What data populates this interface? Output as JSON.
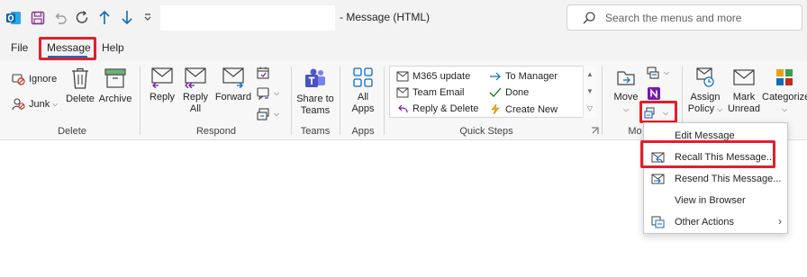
{
  "window": {
    "title": "- Message (HTML)",
    "search_placeholder": "Search the menus and more"
  },
  "menu": {
    "file": "File",
    "message": "Message",
    "help": "Help"
  },
  "ribbon": {
    "delete_group": {
      "ignore": "Ignore",
      "junk": "Junk",
      "delete": "Delete",
      "archive": "Archive",
      "label": "Delete"
    },
    "respond_group": {
      "reply": "Reply",
      "reply_all_line1": "Reply",
      "reply_all_line2": "All",
      "forward": "Forward",
      "label": "Respond"
    },
    "teams_group": {
      "share_line1": "Share to",
      "share_line2": "Teams",
      "label": "Teams"
    },
    "apps_group": {
      "all_apps_line1": "All",
      "all_apps_line2": "Apps",
      "label": "Apps"
    },
    "quick_steps": {
      "items": [
        "M365 update",
        "Team Email",
        "Reply & Delete",
        "To Manager",
        "Done",
        "Create New"
      ],
      "label": "Quick Steps"
    },
    "move_group": {
      "move": "Move",
      "label": "Mo"
    },
    "tags_group": {
      "assign_line1": "Assign",
      "assign_line2": "Policy",
      "mark_line1": "Mark",
      "mark_line2": "Unread",
      "categorize": "Categorize"
    }
  },
  "dropdown": {
    "items": [
      "Edit Message",
      "Recall This Message...",
      "Resend This Message...",
      "View in Browser",
      "Other Actions"
    ]
  },
  "colors": {
    "highlight": "#e0202b",
    "accent": "#0f6cbd",
    "onenote": "#7719aa"
  }
}
